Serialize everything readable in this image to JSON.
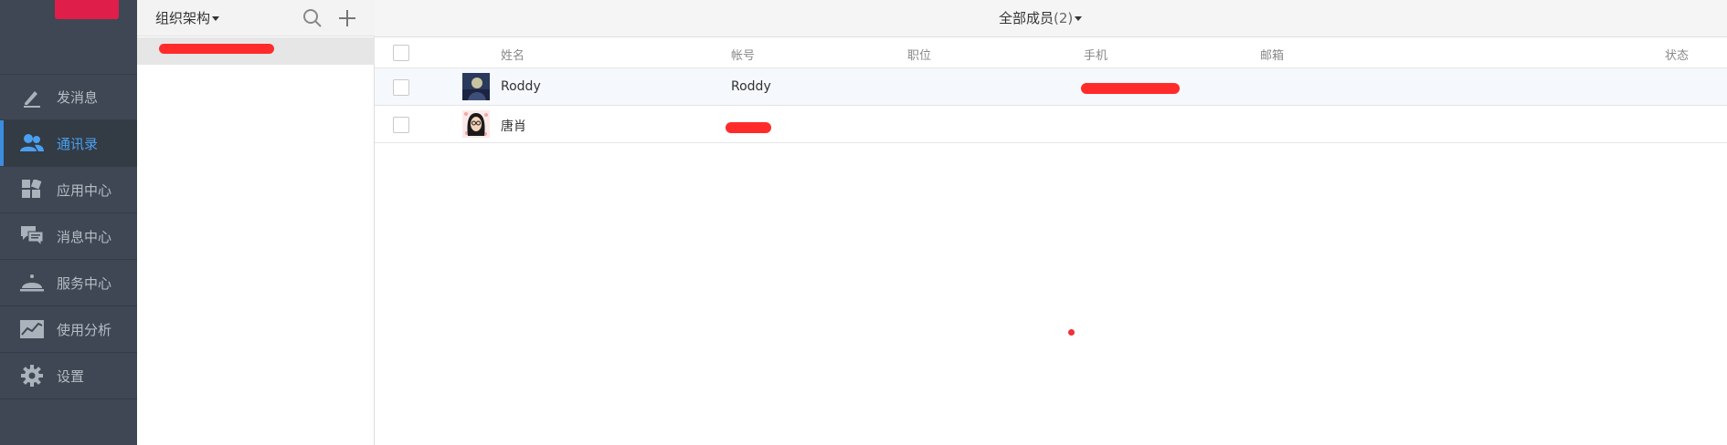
{
  "sidebar": {
    "items": [
      {
        "label": "发消息",
        "icon": "pencil-icon",
        "active": false
      },
      {
        "label": "通讯录",
        "icon": "contacts-icon",
        "active": true
      },
      {
        "label": "应用中心",
        "icon": "apps-icon",
        "active": false
      },
      {
        "label": "消息中心",
        "icon": "chat-icon",
        "active": false
      },
      {
        "label": "服务中心",
        "icon": "service-bell-icon",
        "active": false
      },
      {
        "label": "使用分析",
        "icon": "chart-icon",
        "active": false
      },
      {
        "label": "设置",
        "icon": "gear-icon",
        "active": false
      }
    ]
  },
  "org": {
    "title": "组织架构"
  },
  "main": {
    "title": "全部成员",
    "count": "(2)",
    "columns": {
      "name": "姓名",
      "account": "帐号",
      "position": "职位",
      "phone": "手机",
      "email": "邮箱",
      "status": "状态"
    },
    "members": [
      {
        "name": "Roddy",
        "account": "Roddy"
      },
      {
        "name": "唐肖",
        "account": ""
      }
    ]
  },
  "colors": {
    "sidebar_bg": "#3e4753",
    "accent": "#3c8dde",
    "logo": "#e01e4a",
    "redaction": "#ff2b2b"
  }
}
